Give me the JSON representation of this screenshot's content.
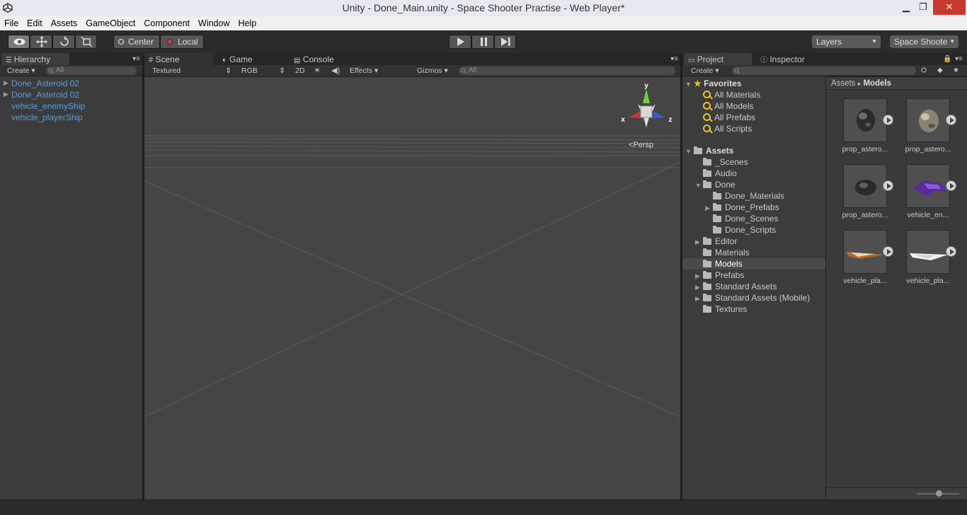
{
  "window": {
    "title": "Unity - Done_Main.unity - Space Shooter Practise - Web Player*",
    "buttons": {
      "minimize": "▁",
      "restore": "❐",
      "close": "✕"
    }
  },
  "menu": [
    "File",
    "Edit",
    "Assets",
    "GameObject",
    "Component",
    "Window",
    "Help"
  ],
  "toolbar": {
    "pivot": "Center",
    "space": "Local",
    "layers": "Layers",
    "layout": "Space Shoote"
  },
  "hierarchy": {
    "tab": "Hierarchy",
    "create": "Create",
    "search_placeholder": "All",
    "items": [
      "Done_Asteroid 02",
      "Done_Asteroid 02",
      "vehicle_enemyShip",
      "vehicle_playerShip"
    ]
  },
  "scene": {
    "tabs": [
      "Scene",
      "Game",
      "Console"
    ],
    "shading": "Textured",
    "render": "RGB",
    "mode2d": "2D",
    "effects": "Effects",
    "gizmos": "Gizmos",
    "search_placeholder": "All",
    "persp": "Persp",
    "axis": {
      "x": "x",
      "y": "y",
      "z": "z"
    }
  },
  "project": {
    "tabs": [
      "Project",
      "Inspector"
    ],
    "create": "Create",
    "favorites_label": "Favorites",
    "favorites": [
      "All Materials",
      "All Models",
      "All Prefabs",
      "All Scripts"
    ],
    "assets_label": "Assets",
    "tree": [
      {
        "label": "_Scenes",
        "depth": 1,
        "expand": ""
      },
      {
        "label": "Audio",
        "depth": 1,
        "expand": ""
      },
      {
        "label": "Done",
        "depth": 1,
        "expand": "open"
      },
      {
        "label": "Done_Materials",
        "depth": 2,
        "expand": ""
      },
      {
        "label": "Done_Prefabs",
        "depth": 2,
        "expand": "closed"
      },
      {
        "label": "Done_Scenes",
        "depth": 2,
        "expand": ""
      },
      {
        "label": "Done_Scripts",
        "depth": 2,
        "expand": ""
      },
      {
        "label": "Editor",
        "depth": 1,
        "expand": "closed"
      },
      {
        "label": "Materials",
        "depth": 1,
        "expand": ""
      },
      {
        "label": "Models",
        "depth": 1,
        "expand": "",
        "selected": true
      },
      {
        "label": "Prefabs",
        "depth": 1,
        "expand": "closed"
      },
      {
        "label": "Standard Assets",
        "depth": 1,
        "expand": "closed"
      },
      {
        "label": "Standard Assets (Mobile)",
        "depth": 1,
        "expand": "closed"
      },
      {
        "label": "Textures",
        "depth": 1,
        "expand": ""
      }
    ],
    "breadcrumb": {
      "root": "Assets",
      "sep": "▸",
      "current": "Models"
    },
    "thumbnails": [
      "prop_astero...",
      "prop_astero...",
      "prop_astero...",
      "vehicle_en...",
      "vehicle_pla...",
      "vehicle_pla..."
    ]
  }
}
